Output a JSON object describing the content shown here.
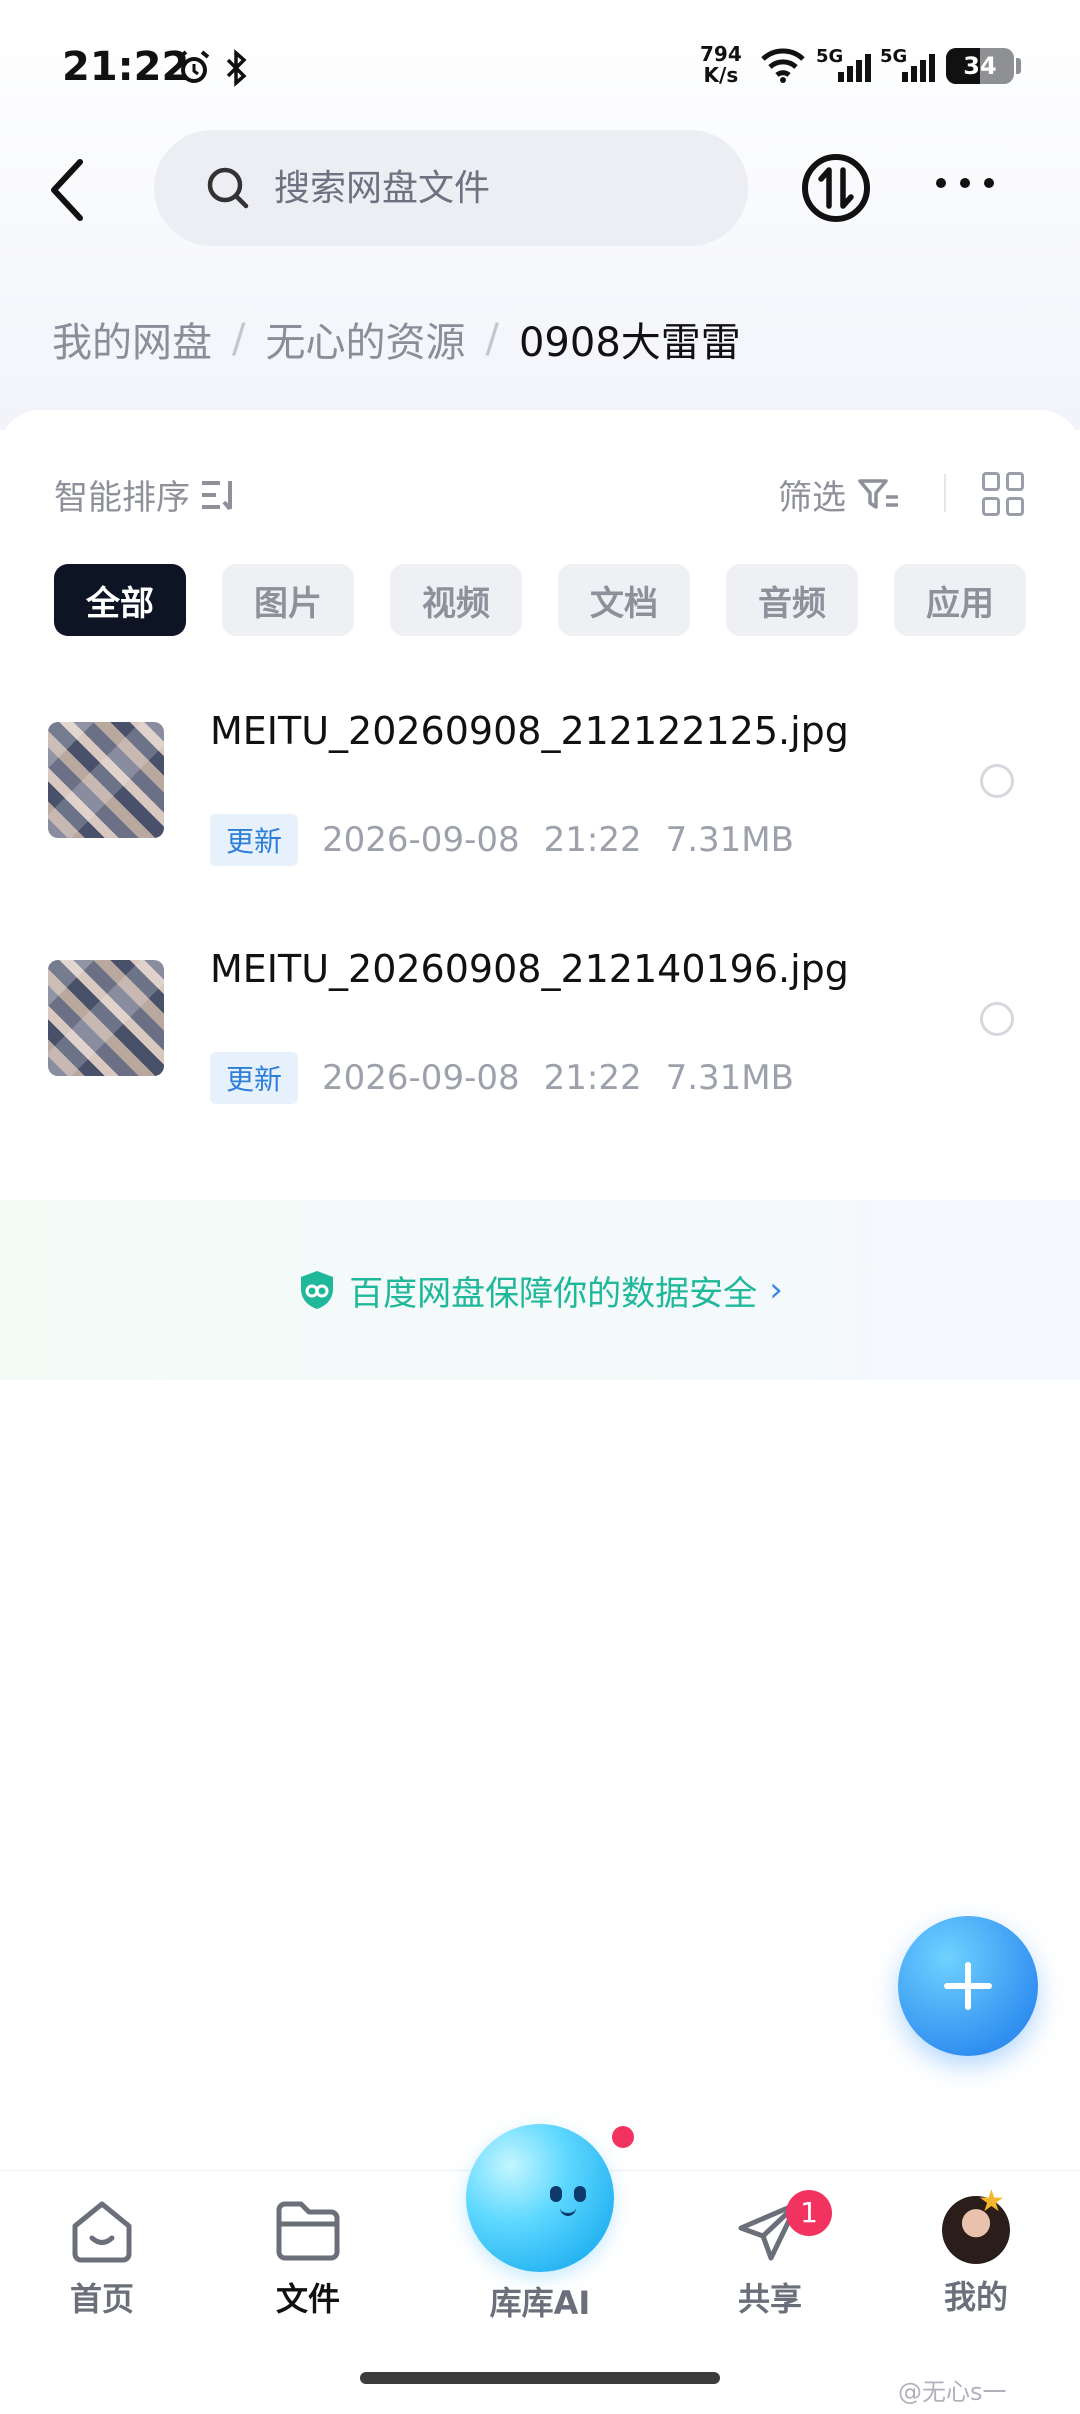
{
  "status_bar": {
    "time": "21:22",
    "net_speed_value": "794",
    "net_speed_unit": "K/s",
    "signal1_label": "5G",
    "signal2_label": "5G",
    "battery": "34"
  },
  "header": {
    "search_placeholder": "搜索网盘文件"
  },
  "breadcrumb": {
    "items": [
      "我的网盘",
      "无心的资源",
      "0908大雷雷"
    ],
    "separator": "/"
  },
  "toolbar": {
    "sort_label": "智能排序",
    "filter_label": "筛选"
  },
  "chips": [
    {
      "label": "全部",
      "active": true
    },
    {
      "label": "图片",
      "active": false
    },
    {
      "label": "视频",
      "active": false
    },
    {
      "label": "文档",
      "active": false
    },
    {
      "label": "音频",
      "active": false
    },
    {
      "label": "应用",
      "active": false
    }
  ],
  "files": [
    {
      "name": "MEITU_20260908_212122125.jpg",
      "badge": "更新",
      "date": "2026-09-08",
      "time": "21:22",
      "size": "7.31MB"
    },
    {
      "name": "MEITU_20260908_212140196.jpg",
      "badge": "更新",
      "date": "2026-09-08",
      "time": "21:22",
      "size": "7.31MB"
    }
  ],
  "safety_notice": "百度网盘保障你的数据安全",
  "bottom_nav": {
    "home": "首页",
    "files": "文件",
    "ai": "库库AI",
    "share": "共享",
    "share_badge": "1",
    "mine": "我的"
  },
  "watermark": "@无心s一",
  "colors": {
    "accent": "#2f8ef0",
    "chip_active_bg": "#0d1424",
    "safety_text": "#1fb89a",
    "badge_red": "#f2335f"
  }
}
